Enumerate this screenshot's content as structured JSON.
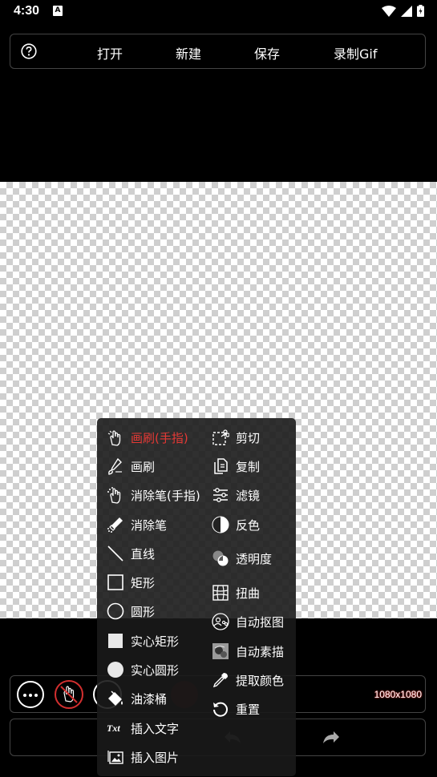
{
  "status_bar": {
    "time": "4:30",
    "notification_icon": "A"
  },
  "top_bar": {
    "help_icon": "help-circle-icon",
    "buttons": [
      {
        "label": "打开"
      },
      {
        "label": "新建"
      },
      {
        "label": "保存"
      },
      {
        "label": "录制Gif"
      }
    ]
  },
  "toolbar": {
    "size_text": "1080x1080",
    "current_color": "#3b0606"
  },
  "tool_menu": {
    "left": [
      {
        "label": "画刷(手指)",
        "icon": "finger-brush-icon",
        "active": true
      },
      {
        "label": "画刷",
        "icon": "brush-icon"
      },
      {
        "label": "消除笔(手指)",
        "icon": "finger-eraser-icon"
      },
      {
        "label": "消除笔",
        "icon": "eraser-pen-icon"
      },
      {
        "label": "直线",
        "icon": "line-icon"
      },
      {
        "label": "矩形",
        "icon": "rectangle-icon"
      },
      {
        "label": "圆形",
        "icon": "circle-icon"
      },
      {
        "label": "实心矩形",
        "icon": "filled-rectangle-icon"
      },
      {
        "label": "实心圆形",
        "icon": "filled-circle-icon"
      },
      {
        "label": "油漆桶",
        "icon": "paint-bucket-icon"
      },
      {
        "label": "插入文字",
        "icon": "text-icon",
        "icon_text": "Txt"
      },
      {
        "label": "插入图片",
        "icon": "image-icon"
      }
    ],
    "right": [
      {
        "label": "剪切",
        "icon": "cut-icon"
      },
      {
        "label": "复制",
        "icon": "copy-icon"
      },
      {
        "label": "滤镜",
        "icon": "filter-icon"
      },
      {
        "label": "反色",
        "icon": "invert-icon"
      },
      {
        "label": "透明度",
        "icon": "opacity-icon"
      },
      {
        "label": "扭曲",
        "icon": "distort-icon"
      },
      {
        "label": "自动抠图",
        "icon": "auto-cutout-icon"
      },
      {
        "label": "自动素描",
        "icon": "auto-sketch-icon"
      },
      {
        "label": "提取颜色",
        "icon": "eyedropper-icon"
      },
      {
        "label": "重置",
        "icon": "reset-icon"
      }
    ]
  }
}
